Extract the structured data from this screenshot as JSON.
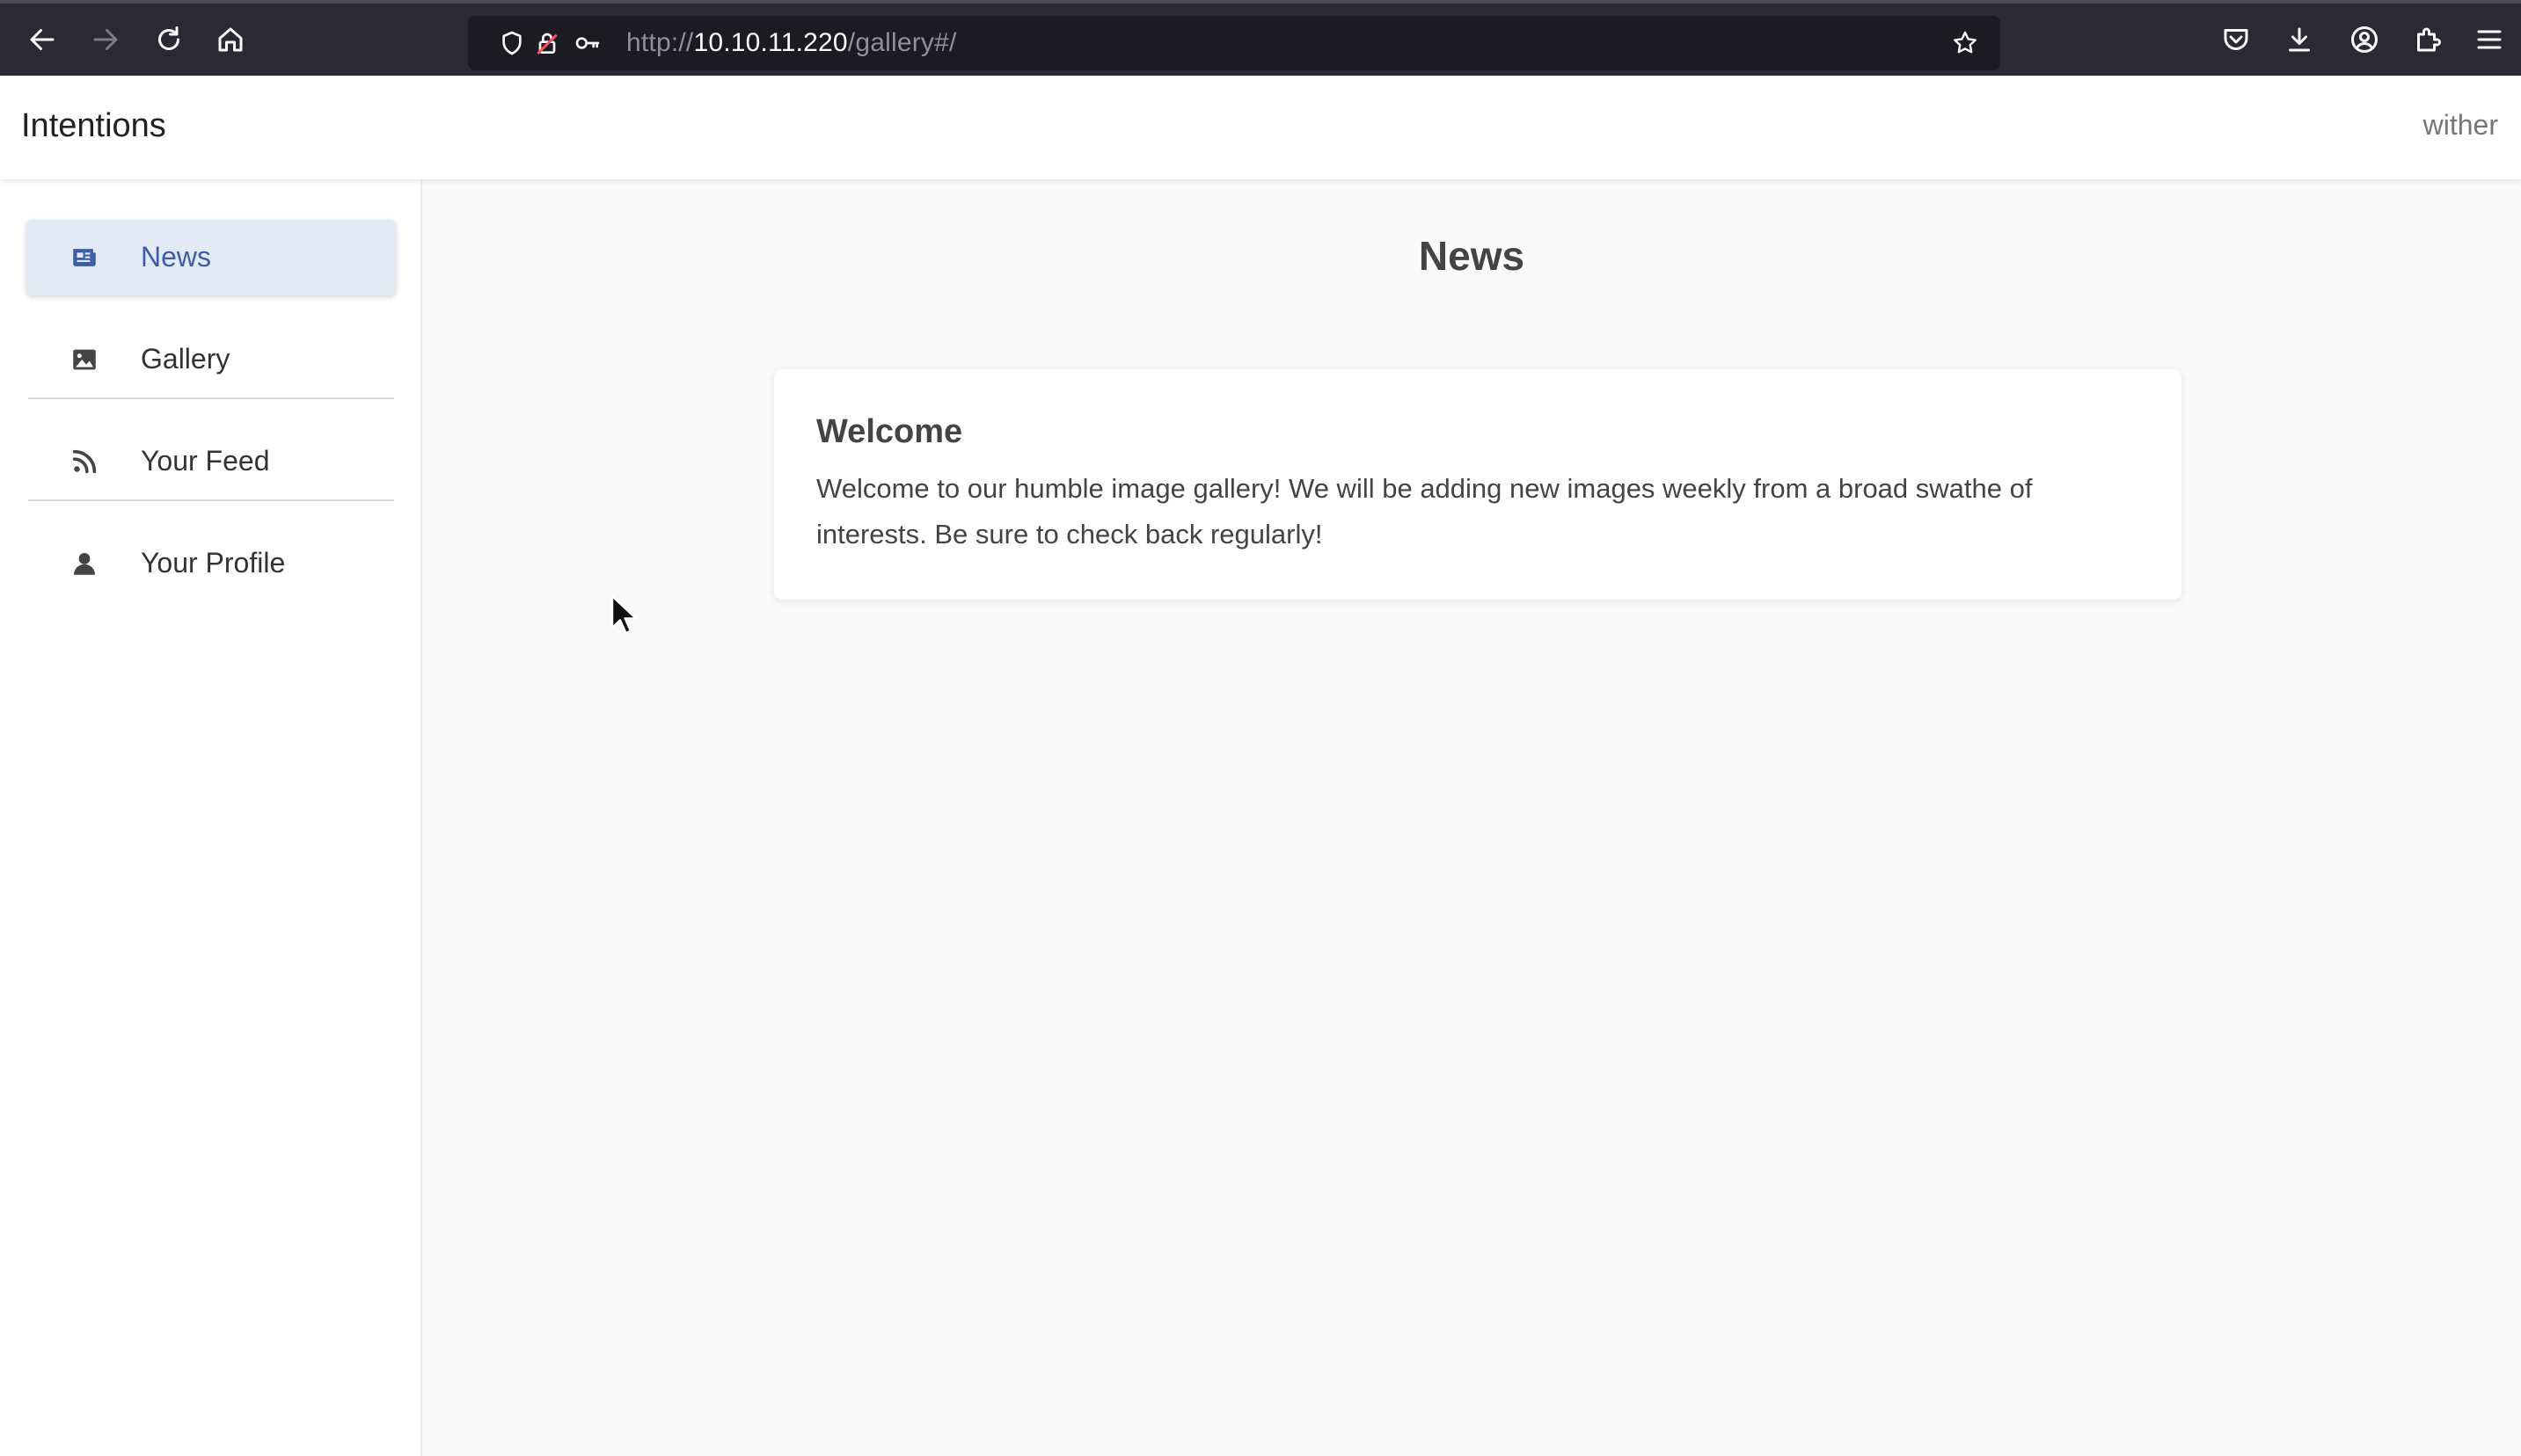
{
  "browser": {
    "url_scheme": "http://",
    "url_host": "10.10.11.220",
    "url_path": "/gallery#/",
    "icons": {
      "back": "arrow-left-icon",
      "forward": "arrow-right-icon",
      "reload": "reload-icon",
      "home": "home-icon",
      "tracking": "shield-icon",
      "insecure": "lock-strike-icon",
      "permissions": "key-icon",
      "bookmark": "star-icon",
      "pocket": "pocket-icon",
      "downloads": "download-icon",
      "account": "account-icon",
      "extensions": "puzzle-icon",
      "menu": "hamburger-icon"
    }
  },
  "header": {
    "title": "Intentions",
    "user": "wither"
  },
  "sidebar": {
    "items": [
      {
        "label": "News",
        "icon": "newspaper-icon",
        "active": true
      },
      {
        "label": "Gallery",
        "icon": "image-icon",
        "active": false
      },
      {
        "label": "Your Feed",
        "icon": "rss-icon",
        "active": false
      },
      {
        "label": "Your Profile",
        "icon": "user-icon",
        "active": false
      }
    ]
  },
  "main": {
    "title": "News",
    "cards": [
      {
        "title": "Welcome",
        "body": "Welcome to our humble image gallery! We will be adding new images weekly from a broad swathe of interests. Be sure to check back regularly!"
      }
    ]
  },
  "colors": {
    "chrome_bg": "#2b2a33",
    "url_bg": "#1c1b22",
    "accent": "#3c5ea8",
    "active_item_bg": "#e3eaf6",
    "page_bg": "#fafafa"
  }
}
